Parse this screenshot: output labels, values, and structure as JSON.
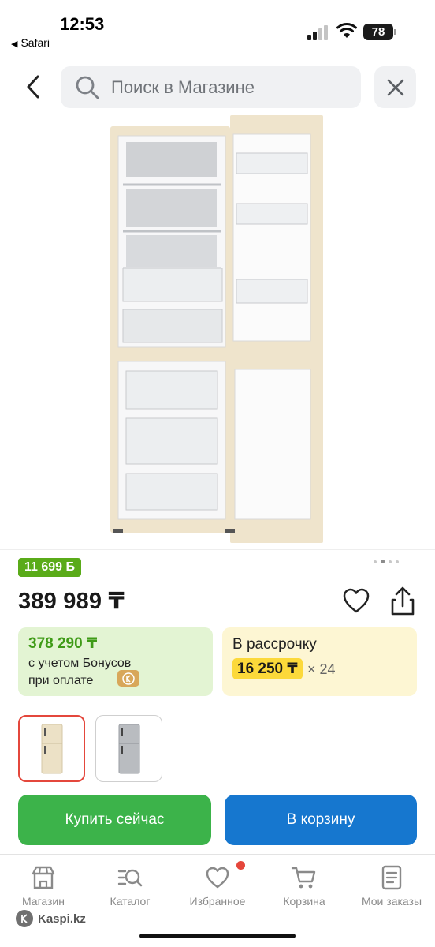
{
  "status_bar": {
    "time": "12:53",
    "back_app": "Safari",
    "battery": "78"
  },
  "search": {
    "placeholder": "Поиск в Магазине"
  },
  "icons": {
    "back": "chevron-left-icon",
    "search": "search-icon",
    "close": "close-icon",
    "favorite": "heart-icon",
    "share": "share-icon"
  },
  "product": {
    "bonus_badge": "11 699 Б",
    "gallery_dots": 4,
    "gallery_active_dot": 2,
    "price": "389 989 ₸",
    "bonus_price": {
      "value": "378 290 ₸",
      "line1": "с учетом Бонусов",
      "line2": "при оплате"
    },
    "installment": {
      "title": "В рассрочку",
      "monthly": "16 250 ₸",
      "term": "× 24"
    },
    "variants": [
      {
        "name": "beige",
        "selected": true
      },
      {
        "name": "silver",
        "selected": false
      }
    ]
  },
  "actions": {
    "buy_now": "Купить сейчас",
    "add_to_cart": "В корзину"
  },
  "tabbar": [
    {
      "label": "Магазин",
      "icon": "shop-icon"
    },
    {
      "label": "Каталог",
      "icon": "catalog-icon"
    },
    {
      "label": "Избранное",
      "icon": "heart-icon",
      "has_badge": true
    },
    {
      "label": "Корзина",
      "icon": "cart-icon"
    },
    {
      "label": "Мои заказы",
      "icon": "orders-icon"
    }
  ],
  "brand": "Kaspi.kz",
  "colors": {
    "green_button": "#3cb34a",
    "blue_button": "#1677cf",
    "bonus_green": "#5aab19",
    "installment_yellow": "#fcd93a",
    "notification_red": "#e5463b"
  }
}
